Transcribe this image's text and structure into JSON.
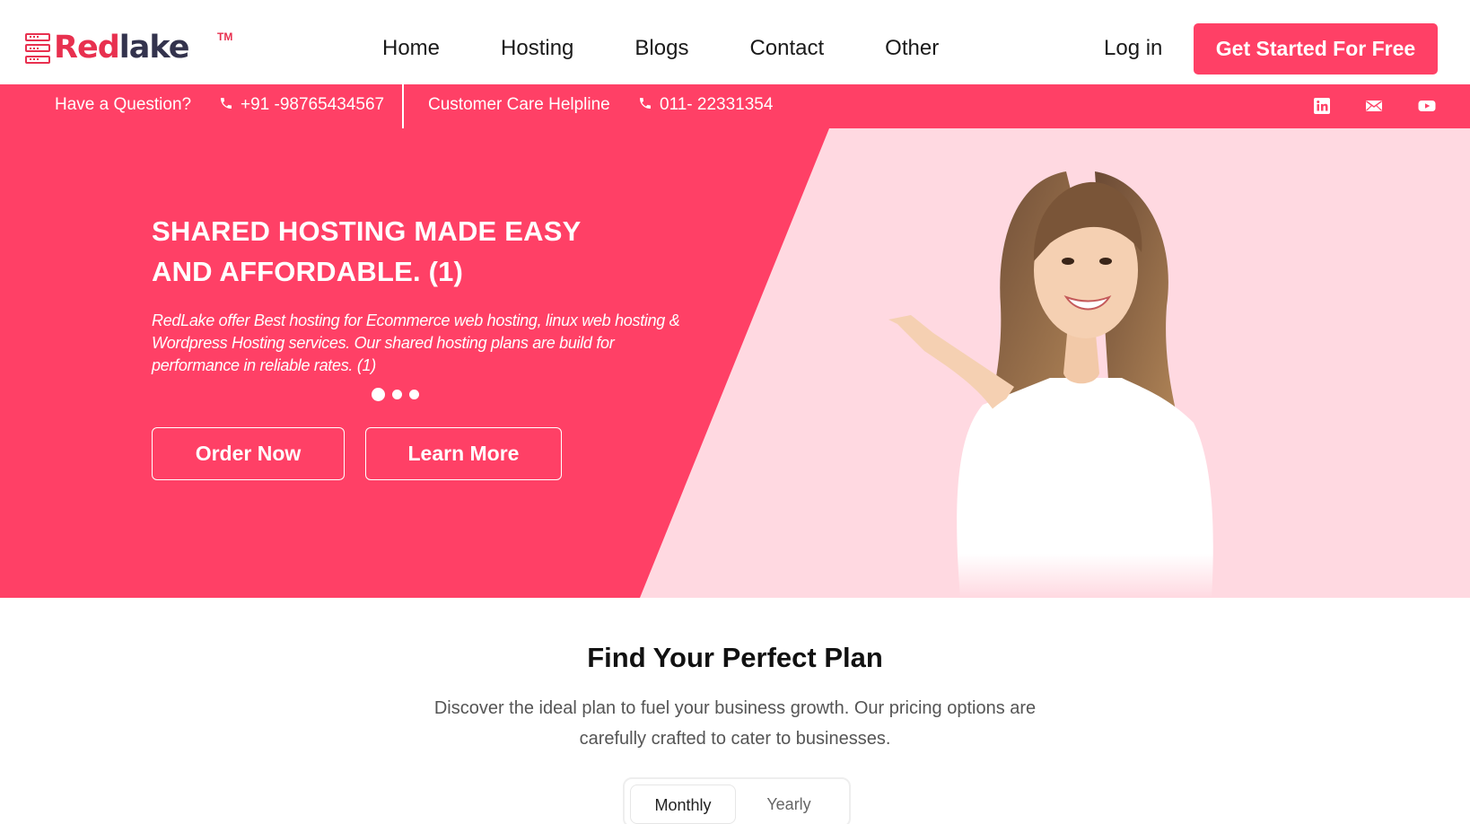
{
  "brand": {
    "name_part1": "Red",
    "name_part2": "lake",
    "trademark": "TM",
    "accent_color": "#ff4066"
  },
  "nav": {
    "items": [
      {
        "label": "Home"
      },
      {
        "label": "Hosting"
      },
      {
        "label": "Blogs"
      },
      {
        "label": "Contact"
      },
      {
        "label": "Other"
      }
    ],
    "login_label": "Log in",
    "cta_label": "Get Started For Free"
  },
  "infobar": {
    "question_label": "Have a Question?",
    "phone": "+91 -98765434567",
    "helpline_label": "Customer Care Helpline",
    "helpline_phone": "011- 22331354",
    "social_icons": [
      "linkedin-icon",
      "mail-icon",
      "youtube-icon"
    ]
  },
  "hero": {
    "title_line1": "SHARED HOSTING MADE EASY",
    "title_line2": "AND AFFORDABLE. (1)",
    "subtitle": "RedLake offer Best hosting for Ecommerce web hosting, linux web hosting & Wordpress Hosting services. Our shared hosting plans are build for performance in reliable rates. (1)",
    "slides_total": 3,
    "active_slide": 1,
    "order_label": "Order Now",
    "learn_label": "Learn More"
  },
  "plans": {
    "title": "Find Your Perfect Plan",
    "description": "Discover the ideal plan to fuel your business growth. Our pricing options are carefully crafted to cater to businesses.",
    "billing_options": [
      "Monthly",
      "Yearly"
    ],
    "selected_billing": "Monthly"
  }
}
